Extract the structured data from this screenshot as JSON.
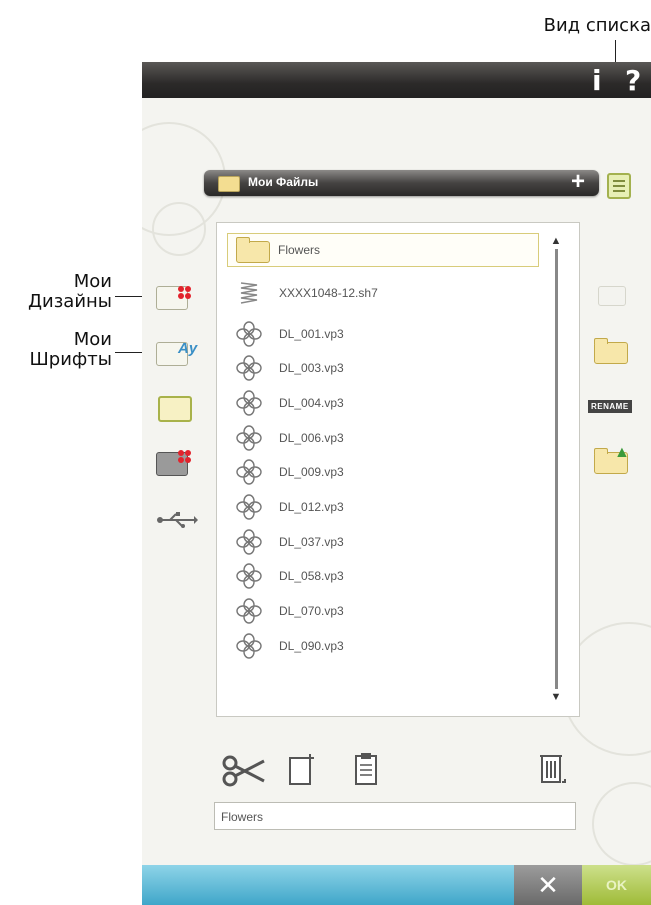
{
  "callouts": {
    "list_view": "Вид списка",
    "my_designs_1": "Мои",
    "my_designs_2": "Дизайны",
    "my_fonts_1": "Мои",
    "my_fonts_2": "Шрифты"
  },
  "topbar": {
    "info": "i",
    "help": "?"
  },
  "folder_bar": {
    "title": "Мои Файлы",
    "add": "+"
  },
  "files": [
    {
      "name": "Flowers",
      "type": "folder",
      "selected": true
    },
    {
      "name": "XXXX1048-12.sh7",
      "type": "stitch"
    },
    {
      "name": "DL_001.vp3",
      "type": "design"
    },
    {
      "name": "DL_003.vp3",
      "type": "design"
    },
    {
      "name": "DL_004.vp3",
      "type": "design"
    },
    {
      "name": "DL_006.vp3",
      "type": "design"
    },
    {
      "name": "DL_009.vp3",
      "type": "design"
    },
    {
      "name": "DL_012.vp3",
      "type": "design"
    },
    {
      "name": "DL_037.vp3",
      "type": "design"
    },
    {
      "name": "DL_058.vp3",
      "type": "design"
    },
    {
      "name": "DL_070.vp3",
      "type": "design"
    },
    {
      "name": "DL_090.vp3",
      "type": "design"
    }
  ],
  "scroll": {
    "up": "▲",
    "down": "▼"
  },
  "right_tools": {
    "rename": "RENAME"
  },
  "name_field": {
    "value": "Flowers"
  },
  "bottom": {
    "cancel": "✕",
    "ok": "OK"
  },
  "colors": {
    "accent_blue": "#3fa6c9",
    "accent_green": "#9fbb38",
    "folder": "#f7e7aa",
    "design_red": "#e2232c"
  },
  "icons": [
    "folder-icon",
    "stitch-file-icon",
    "flower-design-icon",
    "scissors-icon",
    "paste-icon",
    "clipboard-icon",
    "trash-icon",
    "usb-icon",
    "list-view-icon",
    "rename-icon",
    "info-icon",
    "help-icon"
  ]
}
